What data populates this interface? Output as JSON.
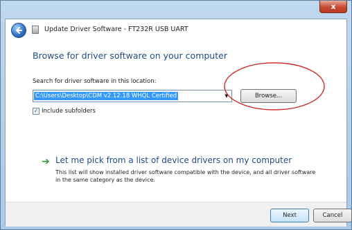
{
  "window": {
    "title": "Update Driver Software - FT232R USB UART",
    "close_label": "x"
  },
  "main": {
    "heading": "Browse for driver software on your computer",
    "search_label": "Search for driver software in this location:",
    "path_value": "C:\\Users\\Desktop\\CDM v2.12.18 WHQL Certified",
    "combo_arrow": "▼",
    "browse_label": "Browse...",
    "include_subfolders_label": "Include subfolders",
    "include_subfolders_checked": true,
    "checkmark": "✓"
  },
  "pick": {
    "arrow": "➔",
    "title": "Let me pick from a list of device drivers on my computer",
    "description": "This list will show installed driver software compatible with the device, and all driver software in the same category as the device."
  },
  "footer": {
    "next_label": "Next",
    "cancel_label": "Cancel"
  },
  "icons": {
    "back": "back-arrow-icon",
    "device": "usb-device-icon",
    "pick": "green-arrow-icon"
  },
  "colors": {
    "heading": "#1e4c8c",
    "selection": "#3399ff",
    "annotation_ellipse": "#d22b2b"
  }
}
